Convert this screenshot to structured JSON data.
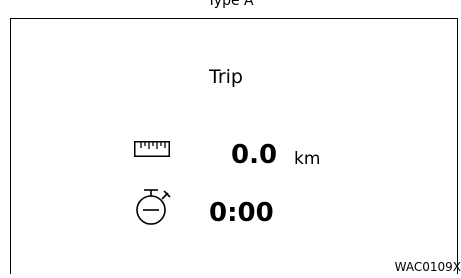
{
  "caption": "Type A",
  "display": {
    "title": "Trip",
    "distance": {
      "value": "0.0",
      "unit": "km",
      "icon": "odometer-ruler-icon"
    },
    "elapsed_time": {
      "value": "0:00",
      "icon": "stopwatch-icon"
    }
  },
  "figure_code": "WAC0109X"
}
